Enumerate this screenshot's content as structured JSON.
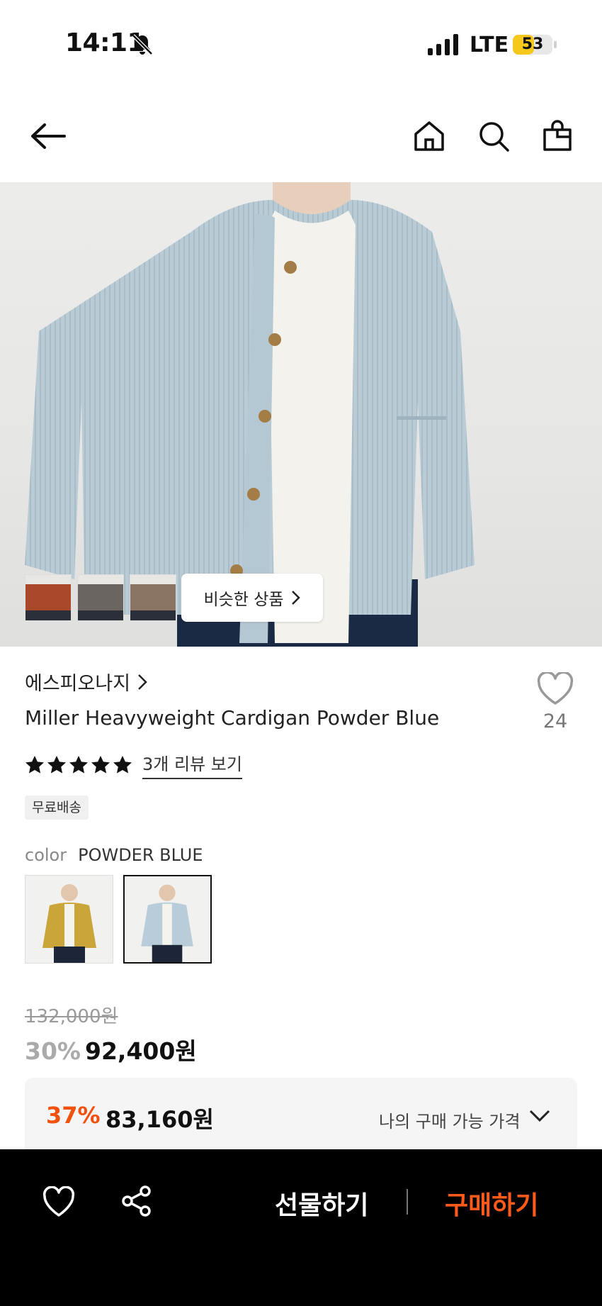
{
  "status_bar": {
    "time": "14:11",
    "network": "LTE",
    "battery": "53",
    "battery_level": 0.53
  },
  "nav": {
    "icons": [
      "back-arrow-icon",
      "home-icon",
      "search-icon",
      "shopping-bag-icon"
    ]
  },
  "hero": {
    "similar_label": "비슷한 상품",
    "thumb_colors": [
      "#a9492a",
      "#6a6560",
      "#8a7565"
    ]
  },
  "product": {
    "brand": "에스피오나지",
    "name": "Miller Heavyweight Cardigan Powder Blue",
    "like_count": "24",
    "rating_stars": 5,
    "review_link": "3개 리뷰 보기",
    "badge": "무료배송"
  },
  "color": {
    "label": "color",
    "value": "POWDER BLUE",
    "swatches": [
      {
        "color": "#c9a53a",
        "selected": false
      },
      {
        "color": "#b8cdd9",
        "selected": true
      }
    ]
  },
  "price": {
    "original": "132,000원",
    "discount_rate": "30%",
    "sale": "92,400원",
    "my_rate": "37%",
    "my_price": "83,160원",
    "my_label": "나의 구매 가능 가격"
  },
  "bottom_bar": {
    "gift_label": "선물하기",
    "buy_label": "구매하기",
    "accent": "#ff5a1a"
  }
}
